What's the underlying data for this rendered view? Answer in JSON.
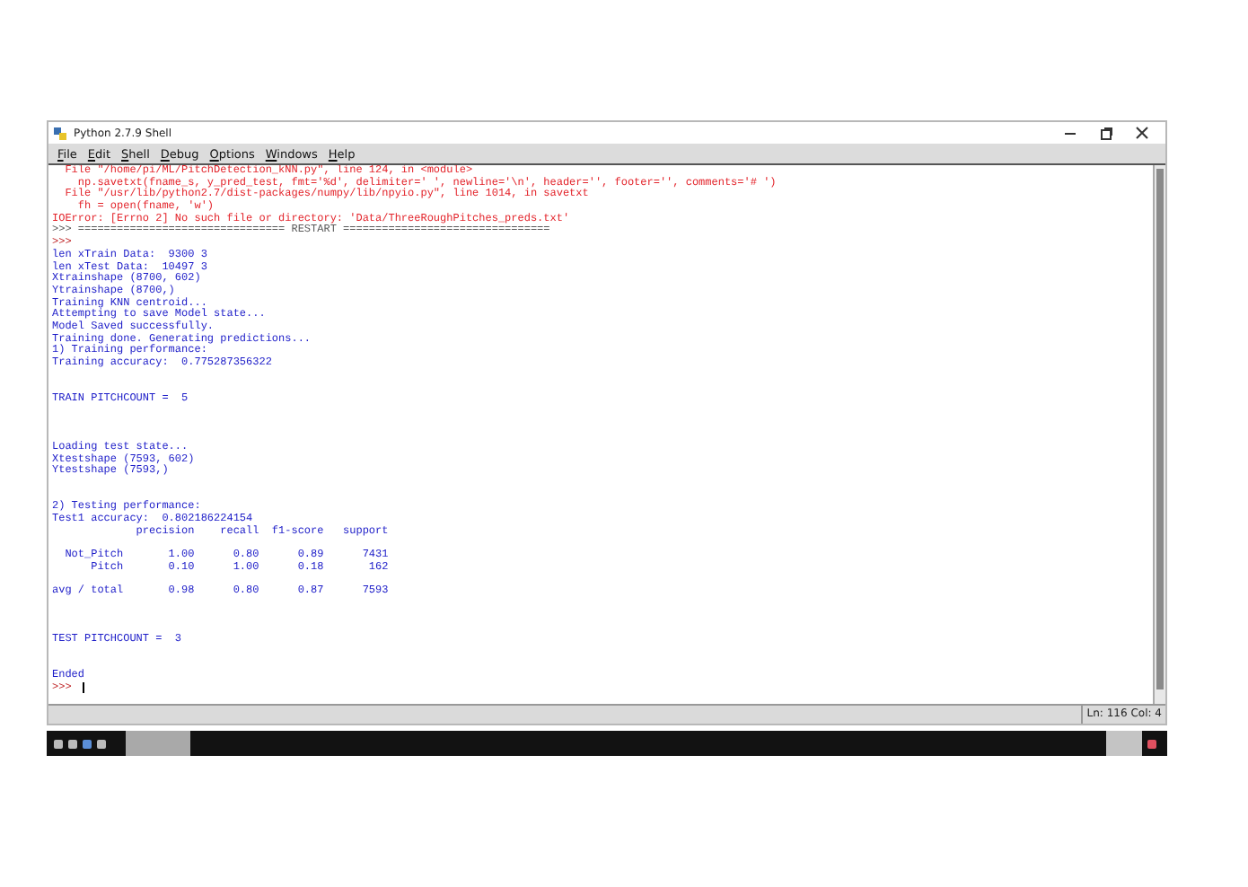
{
  "window": {
    "title": "Python 2.7.9 Shell"
  },
  "menu": [
    "File",
    "Edit",
    "Shell",
    "Debug",
    "Options",
    "Windows",
    "Help"
  ],
  "lines": [
    {
      "kind": "stderr",
      "text": "  File \"/home/pi/ML/PitchDetection_kNN.py\", line 124, in <module>"
    },
    {
      "kind": "stderr",
      "text": "    np.savetxt(fname_s, y_pred_test, fmt='%d', delimiter=' ', newline='\\n', header='', footer='', comments='# ')"
    },
    {
      "kind": "stderr",
      "text": "  File \"/usr/lib/python2.7/dist-packages/numpy/lib/npyio.py\", line 1014, in savetxt"
    },
    {
      "kind": "stderr",
      "text": "    fh = open(fname, 'w')"
    },
    {
      "kind": "stderr",
      "text": "IOError: [Errno 2] No such file or directory: 'Data/ThreeRoughPitches_preds.txt'"
    },
    {
      "kind": "restart",
      "text": ">>> ================================ RESTART ================================"
    },
    {
      "kind": "prompt",
      "text": ">>>"
    },
    {
      "kind": "stdout",
      "text": "len xTrain Data:  9300 3"
    },
    {
      "kind": "stdout",
      "text": "len xTest Data:  10497 3"
    },
    {
      "kind": "stdout",
      "text": "Xtrainshape (8700, 602)"
    },
    {
      "kind": "stdout",
      "text": "Ytrainshape (8700,)"
    },
    {
      "kind": "stdout",
      "text": "Training KNN centroid..."
    },
    {
      "kind": "stdout",
      "text": "Attempting to save Model state..."
    },
    {
      "kind": "stdout",
      "text": "Model Saved successfully."
    },
    {
      "kind": "stdout",
      "text": "Training done. Generating predictions..."
    },
    {
      "kind": "stdout",
      "text": "1) Training performance:"
    },
    {
      "kind": "stdout",
      "text": "Training accuracy:  0.775287356322"
    },
    {
      "kind": "blank"
    },
    {
      "kind": "blank"
    },
    {
      "kind": "stdout",
      "text": "TRAIN PITCHCOUNT =  5"
    },
    {
      "kind": "blank"
    },
    {
      "kind": "blank"
    },
    {
      "kind": "blank"
    },
    {
      "kind": "stdout",
      "text": "Loading test state..."
    },
    {
      "kind": "stdout",
      "text": "Xtestshape (7593, 602)"
    },
    {
      "kind": "stdout",
      "text": "Ytestshape (7593,)"
    },
    {
      "kind": "blank"
    },
    {
      "kind": "blank"
    },
    {
      "kind": "stdout",
      "text": "2) Testing performance:"
    },
    {
      "kind": "stdout",
      "text": "Test1 accuracy:  0.802186224154"
    },
    {
      "kind": "stdout",
      "text": "             precision    recall  f1-score   support"
    },
    {
      "kind": "blank"
    },
    {
      "kind": "stdout",
      "text": "  Not_Pitch       1.00      0.80      0.89      7431"
    },
    {
      "kind": "stdout",
      "text": "      Pitch       0.10      1.00      0.18       162"
    },
    {
      "kind": "blank"
    },
    {
      "kind": "stdout",
      "text": "avg / total       0.98      0.80      0.87      7593"
    },
    {
      "kind": "blank"
    },
    {
      "kind": "blank"
    },
    {
      "kind": "blank"
    },
    {
      "kind": "stdout",
      "text": "TEST PITCHCOUNT =  3"
    },
    {
      "kind": "blank"
    },
    {
      "kind": "blank"
    },
    {
      "kind": "stdout",
      "text": "Ended"
    },
    {
      "kind": "prompt",
      "text": ">>>"
    }
  ],
  "status_bar": {
    "position": "Ln: 116 Col: 4"
  }
}
